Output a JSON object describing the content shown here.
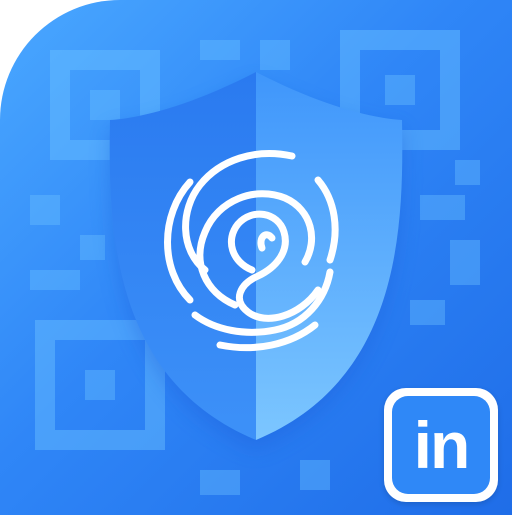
{
  "badge": {
    "label": "in"
  },
  "colors": {
    "background_light": "#4aa8ff",
    "background_dark": "#1f6de8",
    "shield_left": "#2f7ff2",
    "shield_right": "#5fb2ff",
    "fingerprint": "#ffffff",
    "badge_bg": "#2f88f7",
    "badge_border": "#ffffff"
  },
  "icons": [
    "qr-pattern-icon",
    "shield-icon",
    "fingerprint-icon",
    "linkedin-badge-icon"
  ]
}
